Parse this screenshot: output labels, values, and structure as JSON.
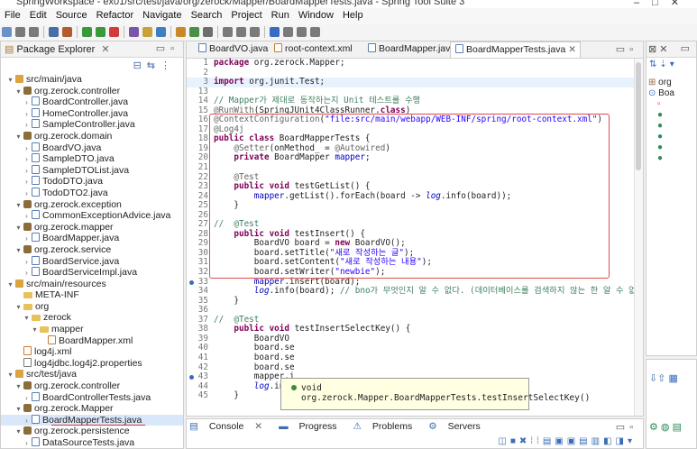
{
  "window": {
    "title": "SpringWorkspace - ex01/src/test/java/org/zerock/Mapper/BoardMapperTests.java - Spring Tool Suite 3"
  },
  "menu": [
    "File",
    "Edit",
    "Source",
    "Refactor",
    "Navigate",
    "Search",
    "Project",
    "Run",
    "Window",
    "Help"
  ],
  "package_explorer": {
    "title": "Package Explorer",
    "tree": [
      {
        "indent": 0,
        "tw": "▾",
        "icon": "src",
        "label": "src/main/java"
      },
      {
        "indent": 1,
        "tw": "▾",
        "icon": "pkg",
        "label": "org.zerock.controller"
      },
      {
        "indent": 2,
        "tw": "›",
        "icon": "java",
        "label": "BoardController.java"
      },
      {
        "indent": 2,
        "tw": "›",
        "icon": "java",
        "label": "HomeController.java"
      },
      {
        "indent": 2,
        "tw": "›",
        "icon": "java",
        "label": "SampleController.java"
      },
      {
        "indent": 1,
        "tw": "▾",
        "icon": "pkg",
        "label": "org.zerock.domain"
      },
      {
        "indent": 2,
        "tw": "›",
        "icon": "java",
        "label": "BoardVO.java"
      },
      {
        "indent": 2,
        "tw": "›",
        "icon": "java",
        "label": "SampleDTO.java"
      },
      {
        "indent": 2,
        "tw": "›",
        "icon": "java",
        "label": "SampleDTOList.java"
      },
      {
        "indent": 2,
        "tw": "›",
        "icon": "java",
        "label": "TodoDTO.java"
      },
      {
        "indent": 2,
        "tw": "›",
        "icon": "java",
        "label": "TodoDTO2.java"
      },
      {
        "indent": 1,
        "tw": "▾",
        "icon": "pkg",
        "label": "org.zerock.exception"
      },
      {
        "indent": 2,
        "tw": "›",
        "icon": "java",
        "label": "CommonExceptionAdvice.java"
      },
      {
        "indent": 1,
        "tw": "▾",
        "icon": "pkg",
        "label": "org.zerock.mapper"
      },
      {
        "indent": 2,
        "tw": "›",
        "icon": "java",
        "label": "BoardMapper.java"
      },
      {
        "indent": 1,
        "tw": "▾",
        "icon": "pkg",
        "label": "org.zerock.service"
      },
      {
        "indent": 2,
        "tw": "›",
        "icon": "java",
        "label": "BoardService.java"
      },
      {
        "indent": 2,
        "tw": "›",
        "icon": "java",
        "label": "BoardServiceImpl.java"
      },
      {
        "indent": 0,
        "tw": "▾",
        "icon": "src",
        "label": "src/main/resources"
      },
      {
        "indent": 1,
        "tw": "",
        "icon": "fold",
        "label": "META-INF"
      },
      {
        "indent": 1,
        "tw": "▾",
        "icon": "fold",
        "label": "org"
      },
      {
        "indent": 2,
        "tw": "▾",
        "icon": "fold",
        "label": "zerock"
      },
      {
        "indent": 3,
        "tw": "▾",
        "icon": "fold",
        "label": "mapper"
      },
      {
        "indent": 4,
        "tw": "",
        "icon": "xml",
        "label": "BoardMapper.xml"
      },
      {
        "indent": 1,
        "tw": "",
        "icon": "xml",
        "label": "log4j.xml"
      },
      {
        "indent": 1,
        "tw": "",
        "icon": "prop",
        "label": "log4jdbc.log4j2.properties"
      },
      {
        "indent": 0,
        "tw": "▾",
        "icon": "src",
        "label": "src/test/java"
      },
      {
        "indent": 1,
        "tw": "▾",
        "icon": "pkg",
        "label": "org.zerock.controller"
      },
      {
        "indent": 2,
        "tw": "›",
        "icon": "java",
        "label": "BoardControllerTests.java"
      },
      {
        "indent": 1,
        "tw": "▾",
        "icon": "pkg",
        "label": "org.zerock.Mapper"
      },
      {
        "indent": 2,
        "tw": "›",
        "icon": "java",
        "label": "BoardMapperTests.java",
        "selected": true
      },
      {
        "indent": 1,
        "tw": "▾",
        "icon": "pkg",
        "label": "org.zerock.persistence"
      },
      {
        "indent": 2,
        "tw": "›",
        "icon": "java",
        "label": "DataSourceTests.java"
      }
    ]
  },
  "editor": {
    "tabs": [
      {
        "label": "BoardVO.java",
        "active": false
      },
      {
        "label": "root-context.xml",
        "active": false
      },
      {
        "label": "BoardMapper.java",
        "active": false
      },
      {
        "label": "BoardMapperTests.java",
        "active": true
      }
    ],
    "lines": [
      {
        "n": "1",
        "html": "<span class=\"kw\">package</span> org.zerock.Mapper;"
      },
      {
        "n": "2",
        "html": ""
      },
      {
        "n": "3",
        "html": "<span class=\"kw\">import</span> org.junit.Test;",
        "hl": true
      },
      {
        "n": "13",
        "html": ""
      },
      {
        "n": "14",
        "html": "<span class=\"cmt\">// Mapper가 제대로 동작하는지 Unit 테스트를 수행</span>"
      },
      {
        "n": "15",
        "html": "<span class=\"ann\">@RunWith</span>(SpringJUnit4ClassRunner.<span class=\"kw\">class</span>)"
      },
      {
        "n": "16",
        "html": "<span class=\"ann\">@ContextConfiguration</span>(<span class=\"str\">\"file:src/main/webapp/WEB-INF/spring/root-context.xml\"</span>)"
      },
      {
        "n": "17",
        "html": "<span class=\"ann\">@Log4j</span>"
      },
      {
        "n": "18",
        "html": "<span class=\"kw\">public class</span> BoardMapperTests {"
      },
      {
        "n": "19",
        "html": "    <span class=\"ann\">@Setter</span>(onMethod_ = <span class=\"ann\">@Autowired</span>)"
      },
      {
        "n": "20",
        "html": "    <span class=\"kw\">private</span> BoardMapper <span class=\"fld\">mapper</span>;"
      },
      {
        "n": "21",
        "html": ""
      },
      {
        "n": "22",
        "html": "    <span class=\"ann\">@Test</span>"
      },
      {
        "n": "23",
        "html": "    <span class=\"kw\">public void</span> testGetList() {"
      },
      {
        "n": "24",
        "html": "        <span class=\"fld\">mapper</span>.getList().forEach(board -> <span class=\"fld ital\">log</span>.info(board));"
      },
      {
        "n": "25",
        "html": "    }"
      },
      {
        "n": "26",
        "html": ""
      },
      {
        "n": "27",
        "html": "<span class=\"cmt\">//  @Test</span>"
      },
      {
        "n": "28",
        "html": "    <span class=\"kw\">public void</span> testInsert() {"
      },
      {
        "n": "29",
        "html": "        BoardVO board = <span class=\"kw\">new</span> BoardVO();"
      },
      {
        "n": "30",
        "html": "        board.setTitle(<span class=\"str\">\"새로 작성하는 글\"</span>);"
      },
      {
        "n": "31",
        "html": "        board.setContent(<span class=\"str\">\"새로 작성하는 내용\"</span>);"
      },
      {
        "n": "32",
        "html": "        board.setWriter(<span class=\"str\">\"newbie\"</span>);"
      },
      {
        "n": "33",
        "html": "        <span class=\"fld\">mapper</span>.insert(board);"
      },
      {
        "n": "34",
        "html": "        <span class=\"fld ital\">log</span>.info(board); <span class=\"cmt\">// bno가 무엇인지 알 수 없다. (데이터베이스를 검색하지 않는 한 알 수 없다.)</span>"
      },
      {
        "n": "35",
        "html": "    }"
      },
      {
        "n": "36",
        "html": ""
      },
      {
        "n": "37",
        "html": "<span class=\"cmt\">//  @Test</span>"
      },
      {
        "n": "38",
        "html": "    <span class=\"kw\">public void</span> testInsertSelectKey() {"
      },
      {
        "n": "39",
        "html": "        BoardVO"
      },
      {
        "n": "40",
        "html": "        board.se"
      },
      {
        "n": "41",
        "html": "        board.se"
      },
      {
        "n": "42",
        "html": "        board.se"
      },
      {
        "n": "43",
        "html": "        mapper.i"
      },
      {
        "n": "44",
        "html": "        <span class=\"fld ital\">log</span>.info(board); <span class=\"cmt\">// bno의 값이 무엇인지 알 수 있다.</span>"
      },
      {
        "n": "45",
        "html": "    }"
      }
    ],
    "tooltip": "void org.zerock.Mapper.BoardMapperTests.testInsertSelectKey()"
  },
  "bottom_panel": {
    "tabs": [
      "Console",
      "Progress",
      "Problems",
      "Servers"
    ]
  },
  "outline": {
    "items": [
      "org",
      "Boa"
    ]
  }
}
